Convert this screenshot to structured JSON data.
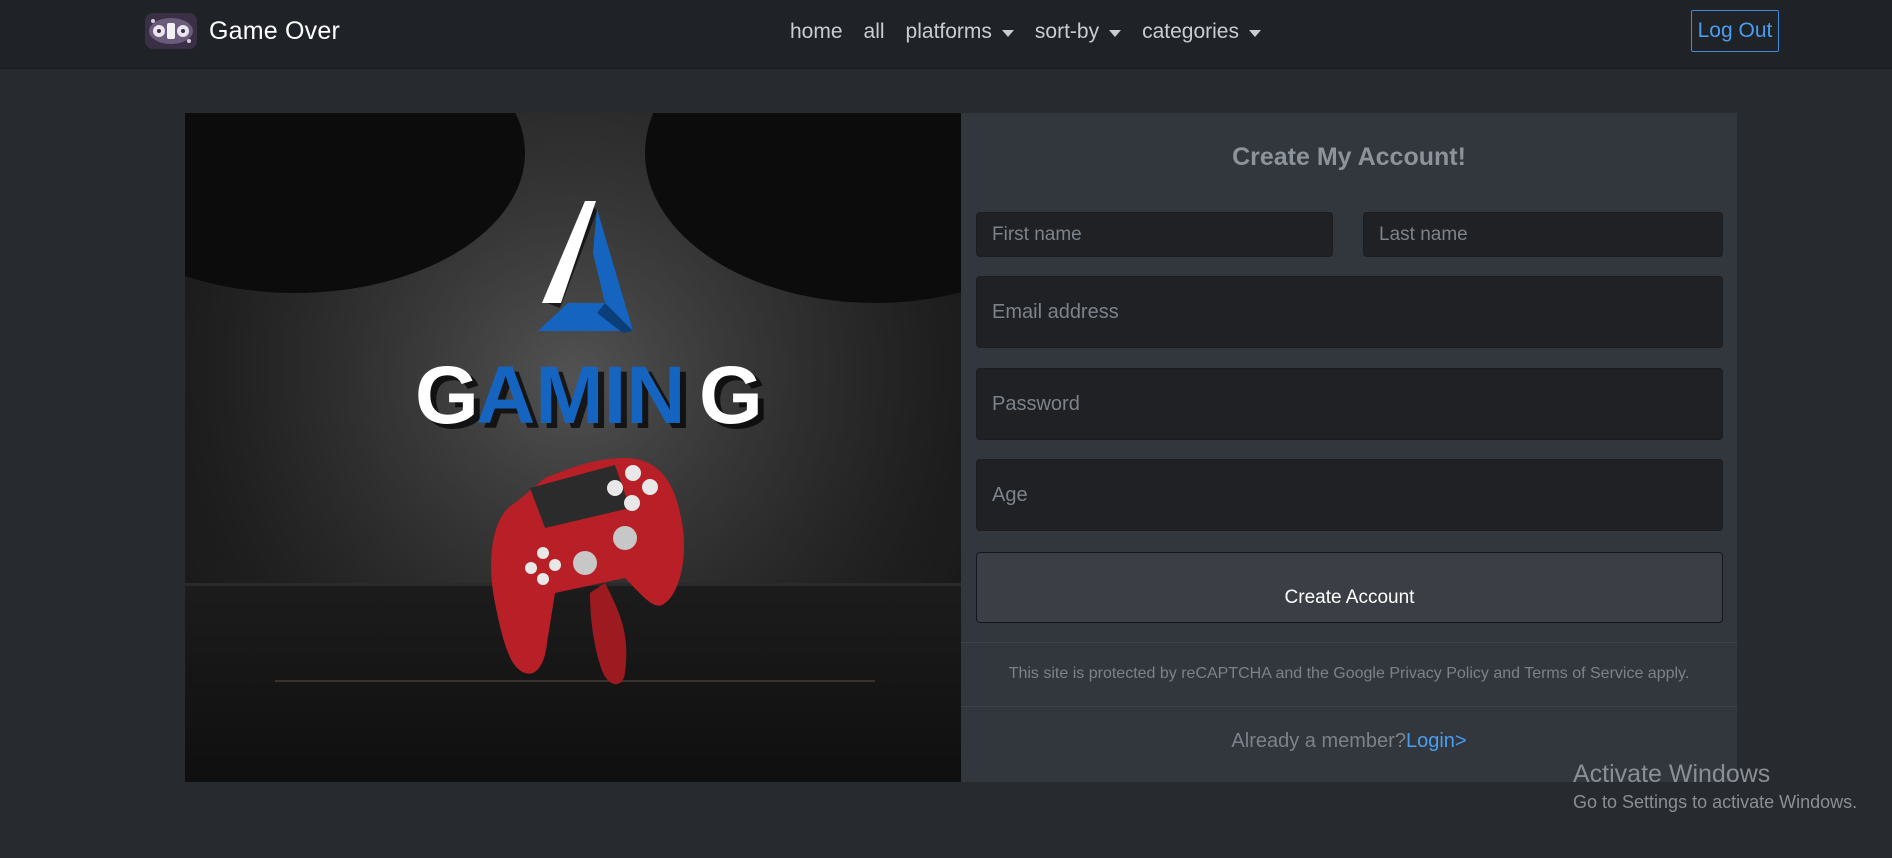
{
  "navbar": {
    "brand": "Game Over",
    "links": {
      "home": "home",
      "all": "all",
      "platforms": "platforms",
      "sort_by": "sort-by",
      "categories": "categories"
    },
    "logout": "Log Out"
  },
  "hero": {
    "logo_text": "GAMING",
    "colors": {
      "blue": "#1565c0",
      "controller_red": "#c4252b"
    }
  },
  "form": {
    "title": "Create My Account!",
    "first_name_placeholder": "First name",
    "last_name_placeholder": "Last name",
    "email_placeholder": "Email address",
    "password_placeholder": "Password",
    "age_placeholder": "Age",
    "submit": "Create Account",
    "recaptcha_note": "This site is protected by reCAPTCHA and the Google Privacy Policy and Terms of Service apply.",
    "member_prompt": "Already a member?",
    "login_link": "Login>"
  },
  "watermark": {
    "title": "Activate Windows",
    "subtitle": "Go to Settings to activate Windows."
  },
  "colors": {
    "background": "#272b30",
    "navbar": "#1f2226",
    "panel": "#32363d",
    "link": "#4a9df0"
  }
}
